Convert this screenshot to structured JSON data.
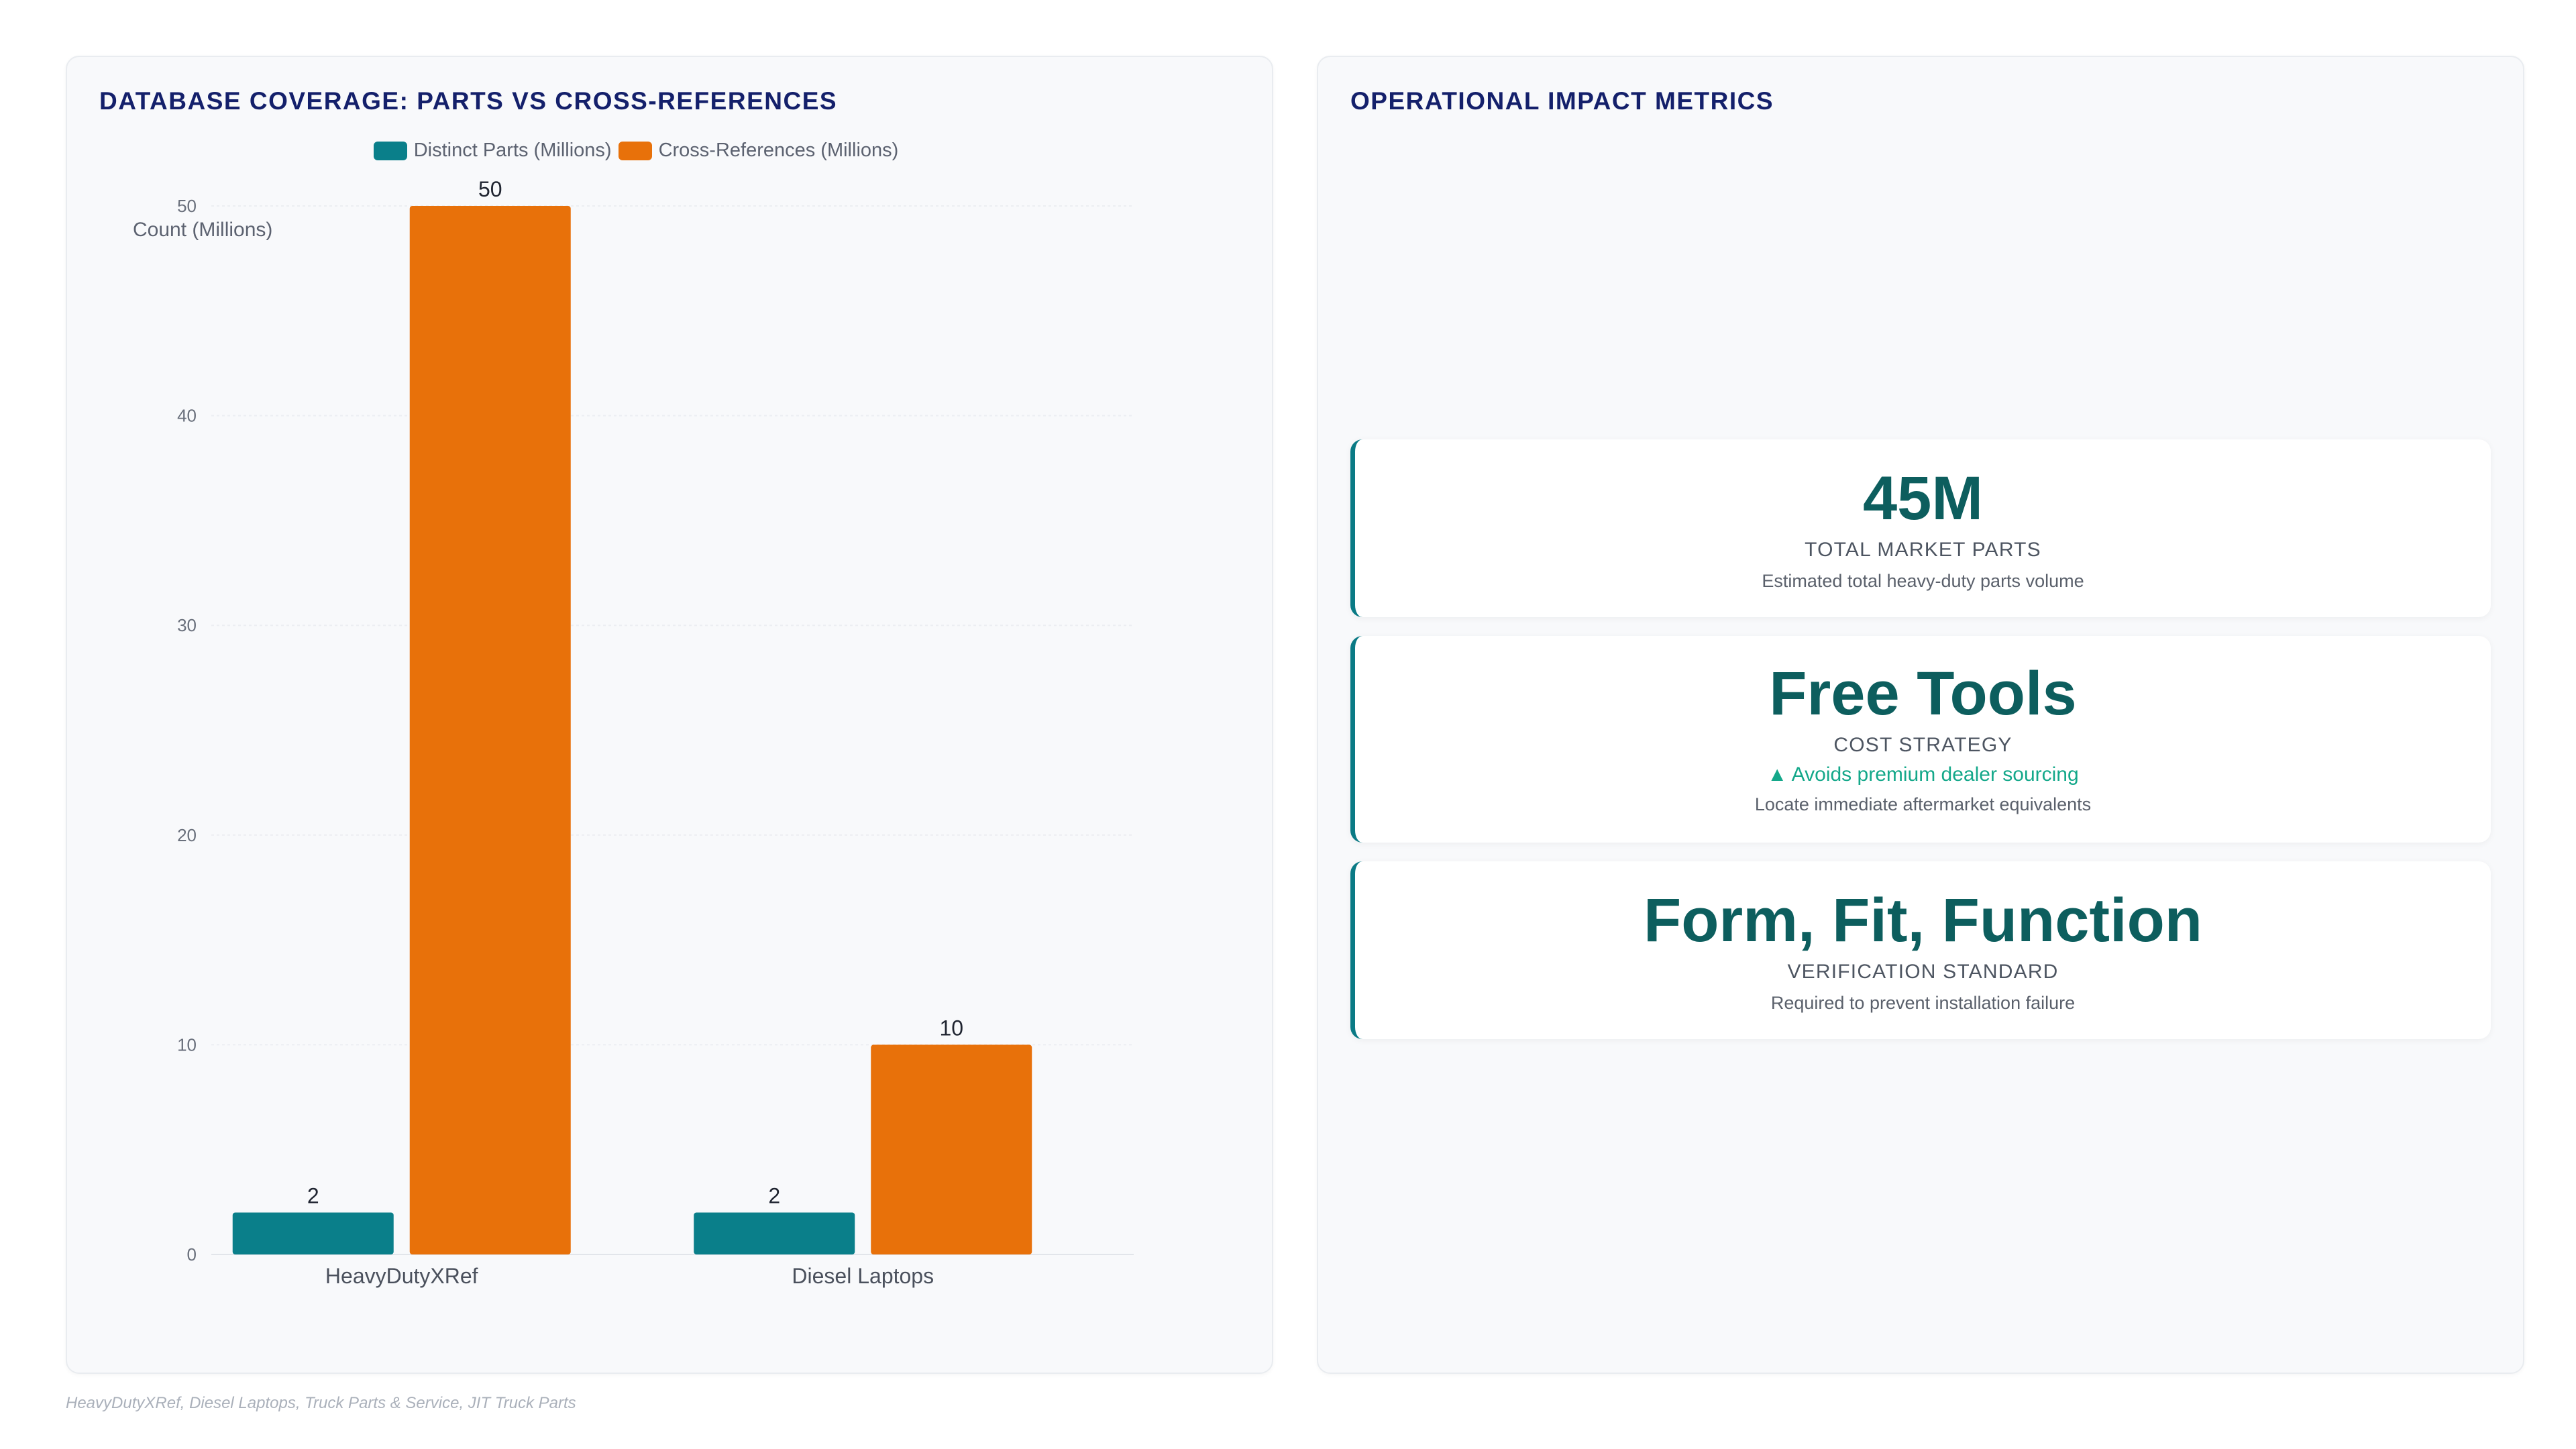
{
  "left_panel": {
    "title": "DATABASE COVERAGE: PARTS VS CROSS-REFERENCES"
  },
  "right_panel": {
    "title": "OPERATIONAL IMPACT METRICS"
  },
  "chart_data": {
    "type": "bar",
    "categories": [
      "HeavyDutyXRef",
      "Diesel Laptops"
    ],
    "series": [
      {
        "name": "Distinct Parts (Millions)",
        "values": [
          2,
          2
        ],
        "color": "#0a7f8a"
      },
      {
        "name": "Cross-References (Millions)",
        "values": [
          50,
          10
        ],
        "color": "#e8710a"
      }
    ],
    "ylabel": "Count (Millions)",
    "xlabel": "",
    "ylim": [
      0,
      50
    ],
    "yticks": [
      0,
      10,
      20,
      30,
      40,
      50
    ],
    "grid": true,
    "legend": "top",
    "data_labels": true
  },
  "metrics": [
    {
      "value": "45M",
      "label": "TOTAL MARKET PARTS",
      "trend": "",
      "desc": "Estimated total heavy-duty parts volume"
    },
    {
      "value": "Free Tools",
      "label": "COST STRATEGY",
      "trend": "▲ Avoids premium dealer sourcing",
      "desc": "Locate immediate aftermarket equivalents"
    },
    {
      "value": "Form, Fit, Function",
      "label": "VERIFICATION STANDARD",
      "trend": "",
      "desc": "Required to prevent installation failure"
    }
  ],
  "source": "HeavyDutyXRef, Diesel Laptops, Truck Parts & Service, JIT Truck Parts"
}
